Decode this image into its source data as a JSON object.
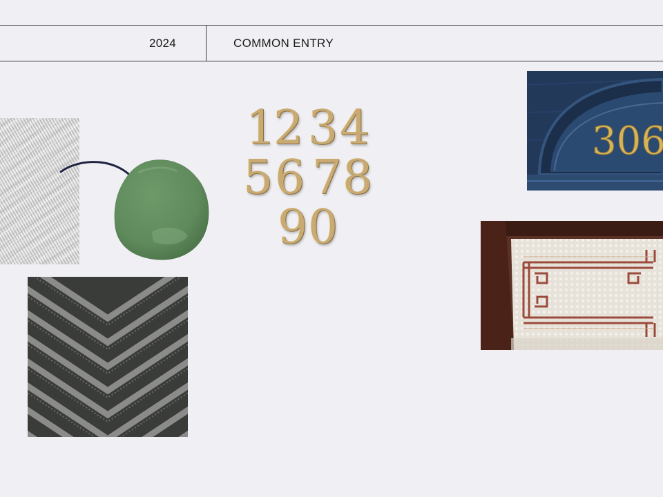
{
  "header": {
    "year": "2024",
    "title": "COMMON ENTRY"
  },
  "brass_numbers": {
    "digits": [
      "1",
      "2",
      "3",
      "4",
      "5",
      "6",
      "7",
      "8",
      "9",
      "0"
    ]
  },
  "door_transom": {
    "house_number": "306"
  },
  "colors": {
    "background": "#f0f0f4",
    "paint_green": "#5f8a5c",
    "brass": "#c8aa72",
    "door_navy": "#1f3552",
    "arrow": "#1e2440"
  },
  "icons": {
    "arrow": "curved-arrow-icon"
  }
}
